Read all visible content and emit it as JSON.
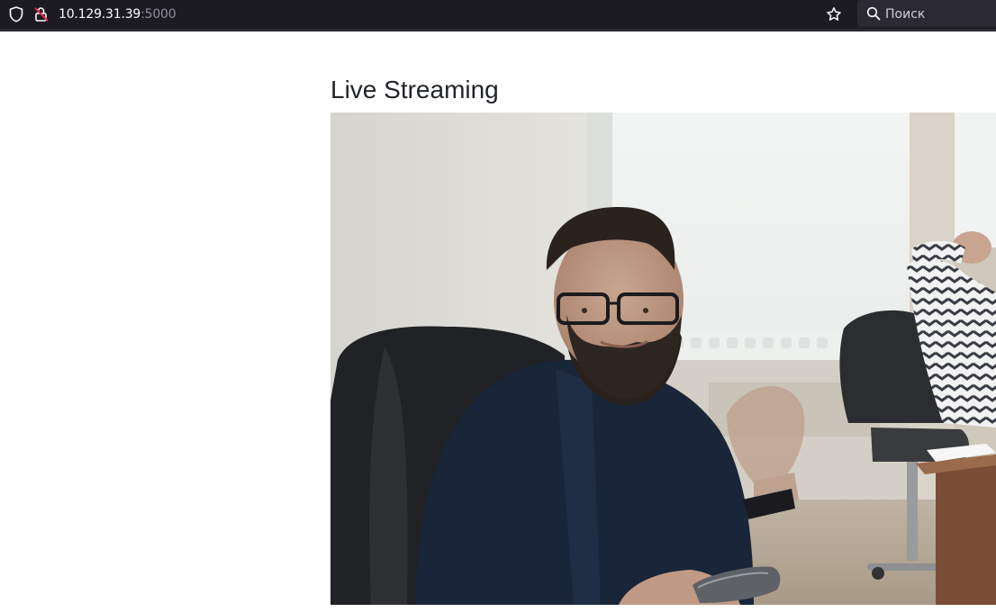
{
  "browser": {
    "url_host": "10.129.31.39",
    "url_port": ":5000",
    "search_placeholder": "Поиск",
    "icons": {
      "tracking_protection": "shield-icon",
      "connection": "insecure-lock-icon",
      "bookmark": "star-icon",
      "search": "search-icon"
    }
  },
  "page": {
    "title": "Live Streaming",
    "video_feed": {
      "description_icon": "camera-frame"
    }
  },
  "colors": {
    "toolbar_bg": "#1c1b22",
    "searchbar_bg": "#2b2a33",
    "url_text": "#fbfbfe",
    "url_port_text": "#8f8f9d",
    "insecure_accent": "#e22850",
    "title_text": "#212529"
  }
}
